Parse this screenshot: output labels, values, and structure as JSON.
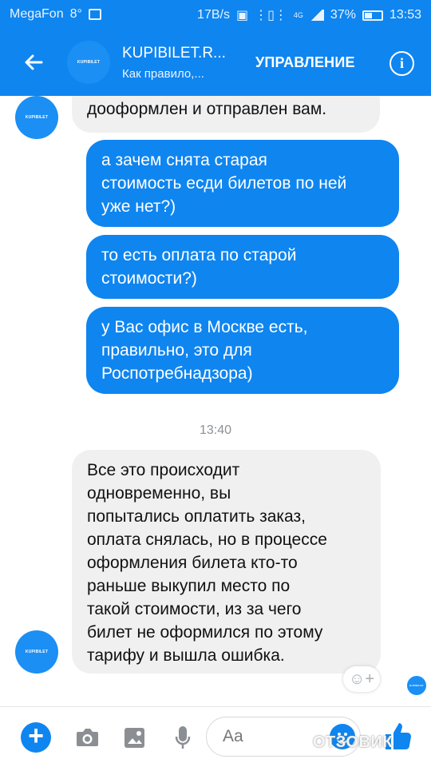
{
  "status_bar": {
    "carrier": "MegaFon",
    "temperature": "8°",
    "network_speed": "17B/s",
    "network_type": "4G",
    "battery": "37%",
    "time": "13:53"
  },
  "header": {
    "avatar_text": "KUPIBILET",
    "title": "KUPIBILET.R...",
    "subtitle": "Как правило,...",
    "manage_label": "УПРАВЛЕНИЕ",
    "info_icon": "info-icon"
  },
  "messages": [
    {
      "type": "incoming",
      "text": "дооформлен и отправлен вам."
    },
    {
      "type": "outgoing",
      "text": "а зачем снята старая\nстоимость есди билетов по ней\nуже нет?)"
    },
    {
      "type": "outgoing",
      "text": "то есть оплата по старой\nстоимости?)"
    },
    {
      "type": "outgoing",
      "text": "у Вас  офис в Москве есть,\nправильно, это для\nРоспотребнадзора)"
    },
    {
      "type": "incoming",
      "text": "Все это происходит\nодновременно, вы\nпопытались оплатить заказ,\nоплата снялась, но в процессе\nоформления билета кто-то\nраньше выкупил место по\nтакой стоимости, из за чего\nбилет не оформился по этому\nтарифу и вышла ошибка."
    }
  ],
  "timestamp": "13:40",
  "composer": {
    "placeholder": "Aa"
  },
  "watermark": "ОТЗОВИК",
  "colors": {
    "brand": "#0f85f0",
    "incoming_bubble": "#f1f0f0",
    "outgoing_text": "#ffffff"
  }
}
